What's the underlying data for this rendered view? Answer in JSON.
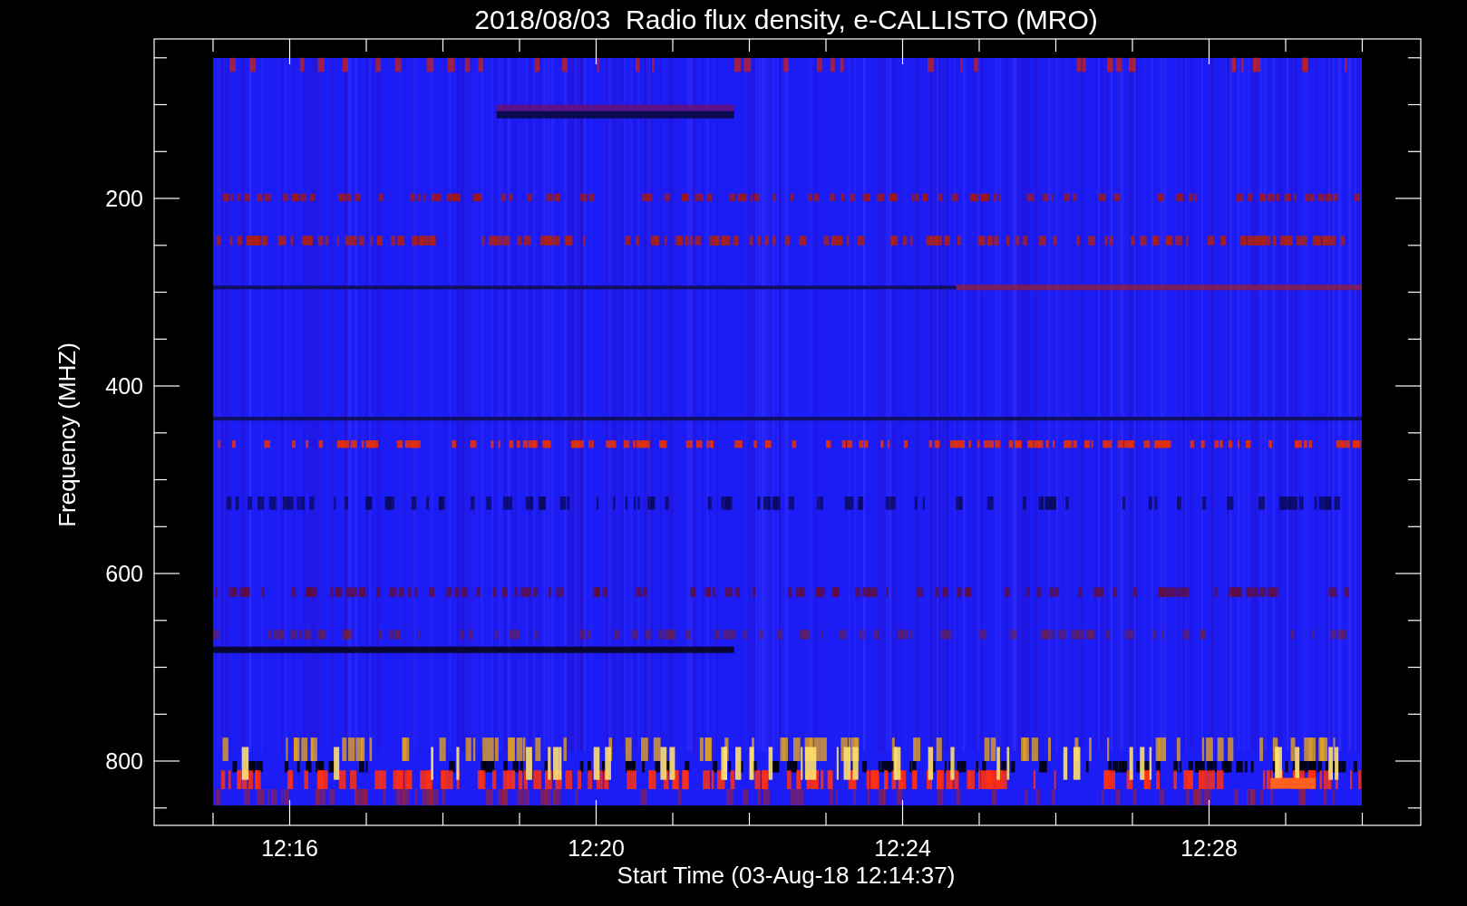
{
  "title": "2018/08/03  Radio flux density, e-CALLISTO (MRO)",
  "y_axis": {
    "label": "Frequency (MHZ)",
    "ticks": [
      "200",
      "400",
      "600",
      "800"
    ]
  },
  "x_axis": {
    "label": "Start Time (03-Aug-18 12:14:37)",
    "ticks": [
      "12:16",
      "12:20",
      "12:24",
      "12:28"
    ]
  }
}
